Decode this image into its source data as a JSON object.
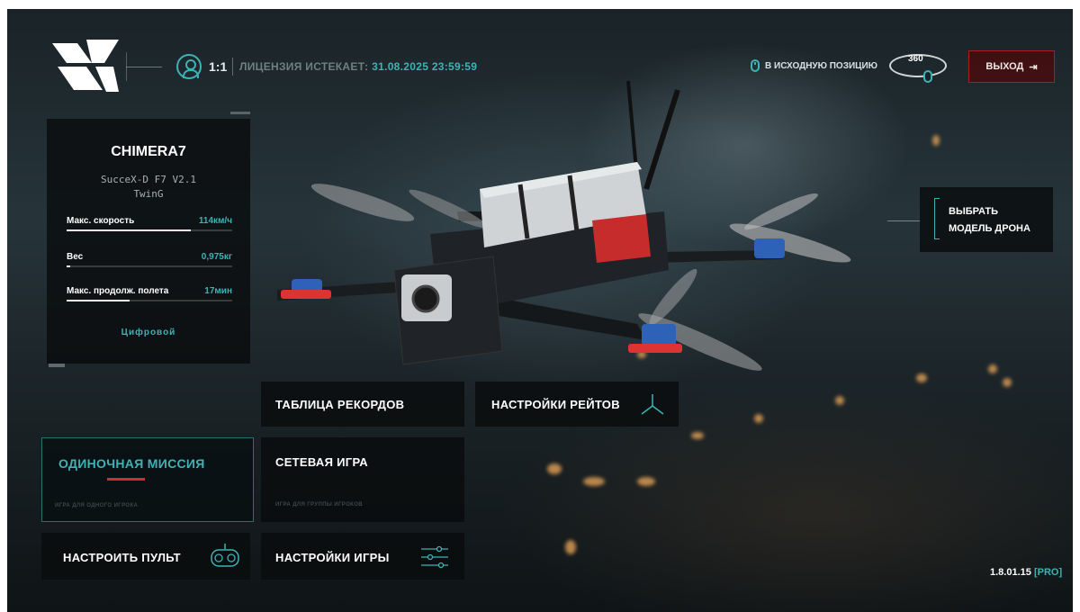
{
  "page_caption_fragment": "",
  "header": {
    "ratio": "1:1",
    "license_label": "ЛИЦЕНЗИЯ ИСТЕКАЕТ:",
    "license_date": "31.08.2025 23:59:59",
    "home_position": "В ИСХОДНУЮ ПОЗИЦИЮ",
    "rotate_label": "360",
    "exit_label": "ВЫХОД"
  },
  "drone_panel": {
    "name": "CHIMERA7",
    "controller_line1": "SucceX-D F7 V2.1",
    "controller_line2": "TwinG",
    "stats": [
      {
        "label": "Макс. скорость",
        "value": "114км/ч",
        "fill": 0.75
      },
      {
        "label": "Вес",
        "value": "0,975кг",
        "fill": 0.02
      },
      {
        "label": "Макс. продолж. полета",
        "value": "17мин",
        "fill": 0.38
      }
    ],
    "video": "Цифровой"
  },
  "select_drone": {
    "line1": "ВЫБРАТЬ",
    "line2": "МОДЕЛЬ ДРОНА"
  },
  "menu": {
    "leaderboard": "ТАБЛИЦА РЕКОРДОВ",
    "rates": "НАСТРОЙКИ РЕЙТОВ",
    "single": "ОДИНОЧНАЯ МИССИЯ",
    "single_sub": "ИГРА ДЛЯ ОДНОГО ИГРОКА",
    "network": "СЕТЕВАЯ ИГРА",
    "network_sub": "ИГРА ДЛЯ ГРУППЫ ИГРОКОВ",
    "controller": "НАСТРОИТЬ ПУЛЬТ",
    "game_settings": "НАСТРОЙКИ ИГРЫ"
  },
  "version": {
    "number": "1.8.01.15",
    "edition": "[PRO]"
  },
  "colors": {
    "accent": "#3fb2b6",
    "danger": "#d72a2a",
    "panel": "#0a0c0e"
  }
}
